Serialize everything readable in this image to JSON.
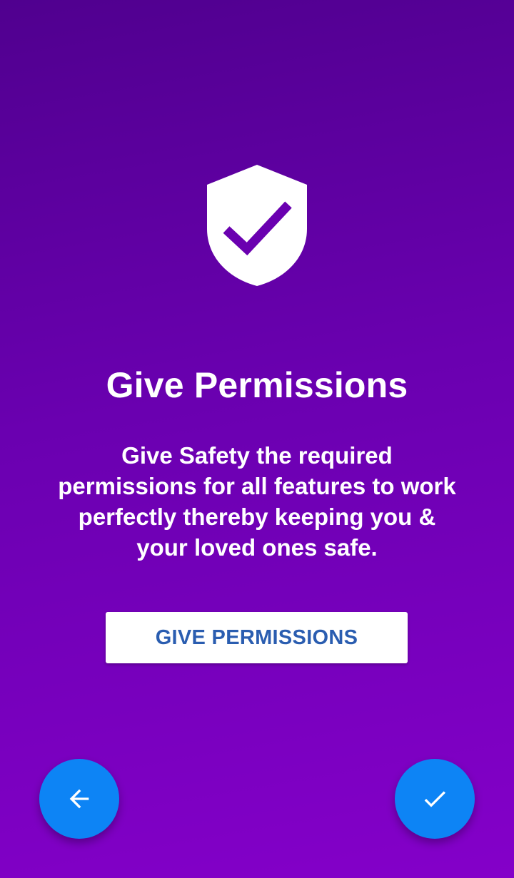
{
  "onboarding": {
    "icon": "shield-check-icon",
    "title": "Give Permissions",
    "description": "Give Safety the required permissions for all features to work perfectly thereby keeping you & your loved ones safe.",
    "primary_button_label": "GIVE PERMISSIONS"
  },
  "navigation": {
    "back_icon": "arrow-left-icon",
    "done_icon": "check-icon"
  },
  "colors": {
    "background_top": "#50008f",
    "background_bottom": "#8400c9",
    "fab": "#0d84f5",
    "button_text": "#2a5db0"
  }
}
